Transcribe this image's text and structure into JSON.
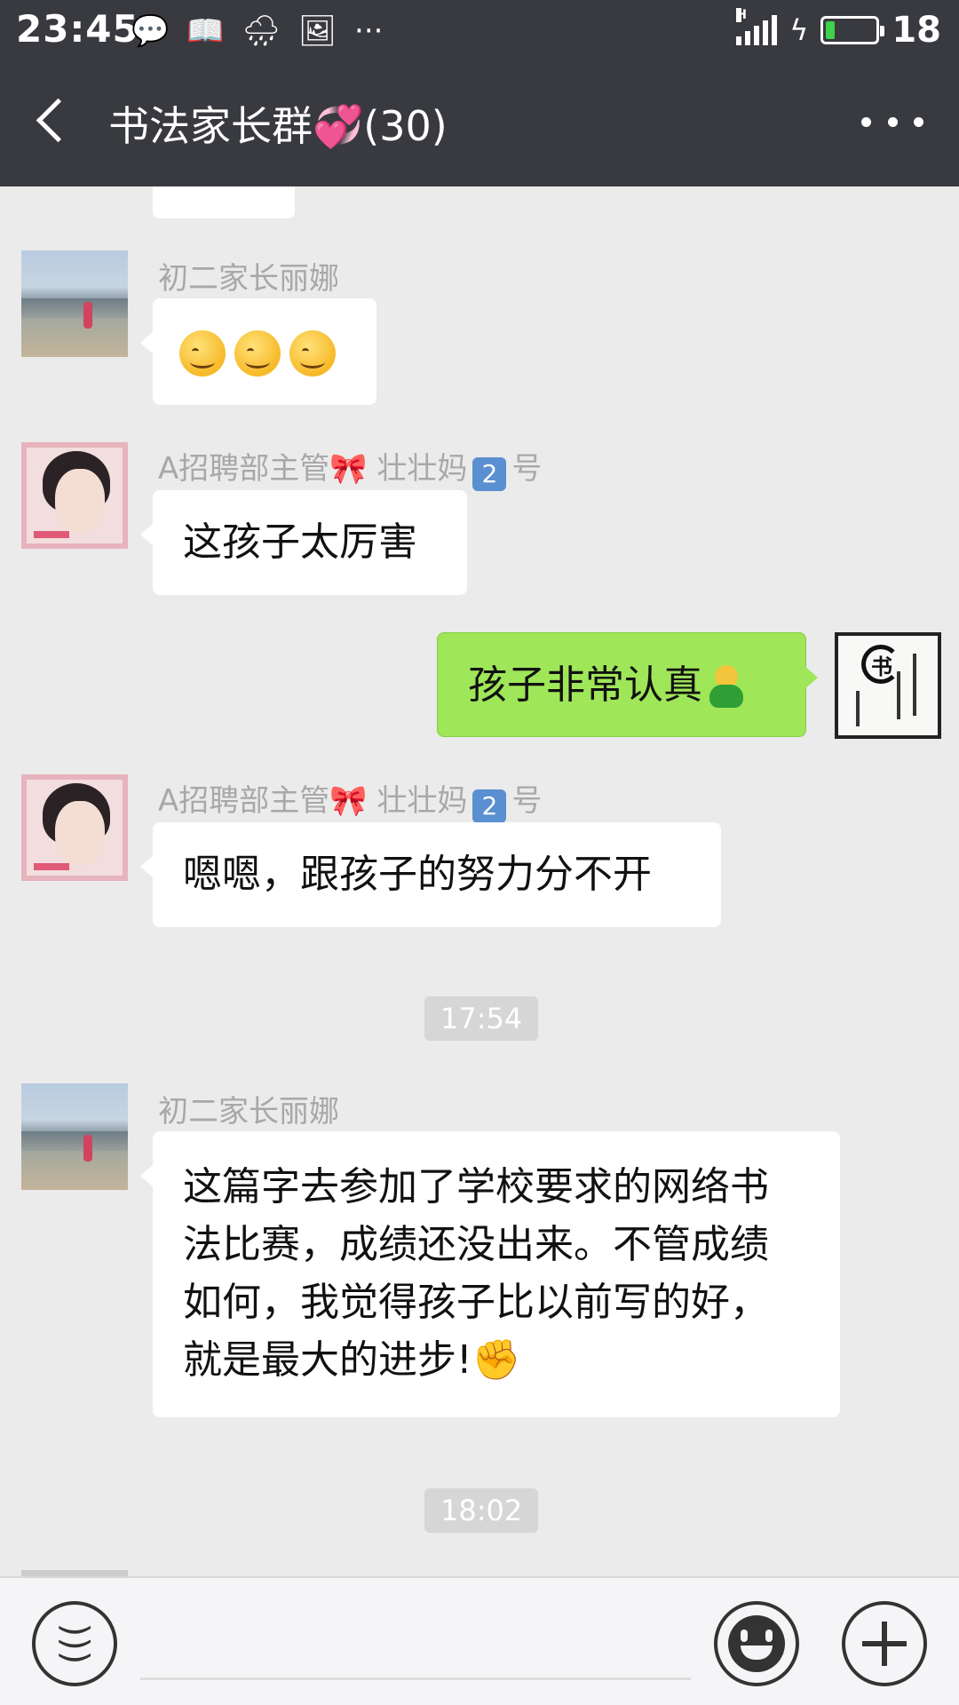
{
  "status_bar": {
    "time": "23:45",
    "battery_level": "18",
    "network": "H",
    "icons": [
      "message-icon",
      "reader-icon",
      "weather-icon",
      "image-icon",
      "more-dots-icon"
    ]
  },
  "header": {
    "title": "书法家长群💞(30)"
  },
  "messages": [
    {
      "side": "left",
      "sender": "初二家长丽娜",
      "type": "emoji",
      "text": "😊😊😊"
    },
    {
      "side": "left",
      "sender_prefix": "A招聘部主管",
      "sender_bow": "🎀",
      "sender_mid": "壮壮妈",
      "sender_badge": "2",
      "sender_suffix": "号",
      "text": "这孩子太厉害"
    },
    {
      "side": "right",
      "text": "孩子非常认真"
    },
    {
      "side": "left",
      "sender_prefix": "A招聘部主管",
      "sender_bow": "🎀",
      "sender_mid": "壮壮妈",
      "sender_badge": "2",
      "sender_suffix": "号",
      "text": "嗯嗯，跟孩子的努力分不开"
    },
    {
      "side": "left",
      "sender": "初二家长丽娜",
      "lines": [
        "这篇字去参加了学校要求的网络书",
        "法比赛，成绩还没出来。不管成绩",
        "如何，我觉得孩子比以前写的好，",
        "就是最大的进步!"
      ],
      "trailing_emoji": "✊"
    }
  ],
  "timestamps": [
    "17:54",
    "18:02"
  ],
  "input_bar": {
    "left_icon": "voice-icon",
    "emoji_icon": "emoji-icon",
    "plus_icon": "plus-icon"
  },
  "colors": {
    "header_bg": "#393a3f",
    "chat_bg": "#ebebeb",
    "my_bubble": "#9fe658",
    "their_bubble": "#ffffff",
    "badge_blue": "#5a8fd1"
  }
}
